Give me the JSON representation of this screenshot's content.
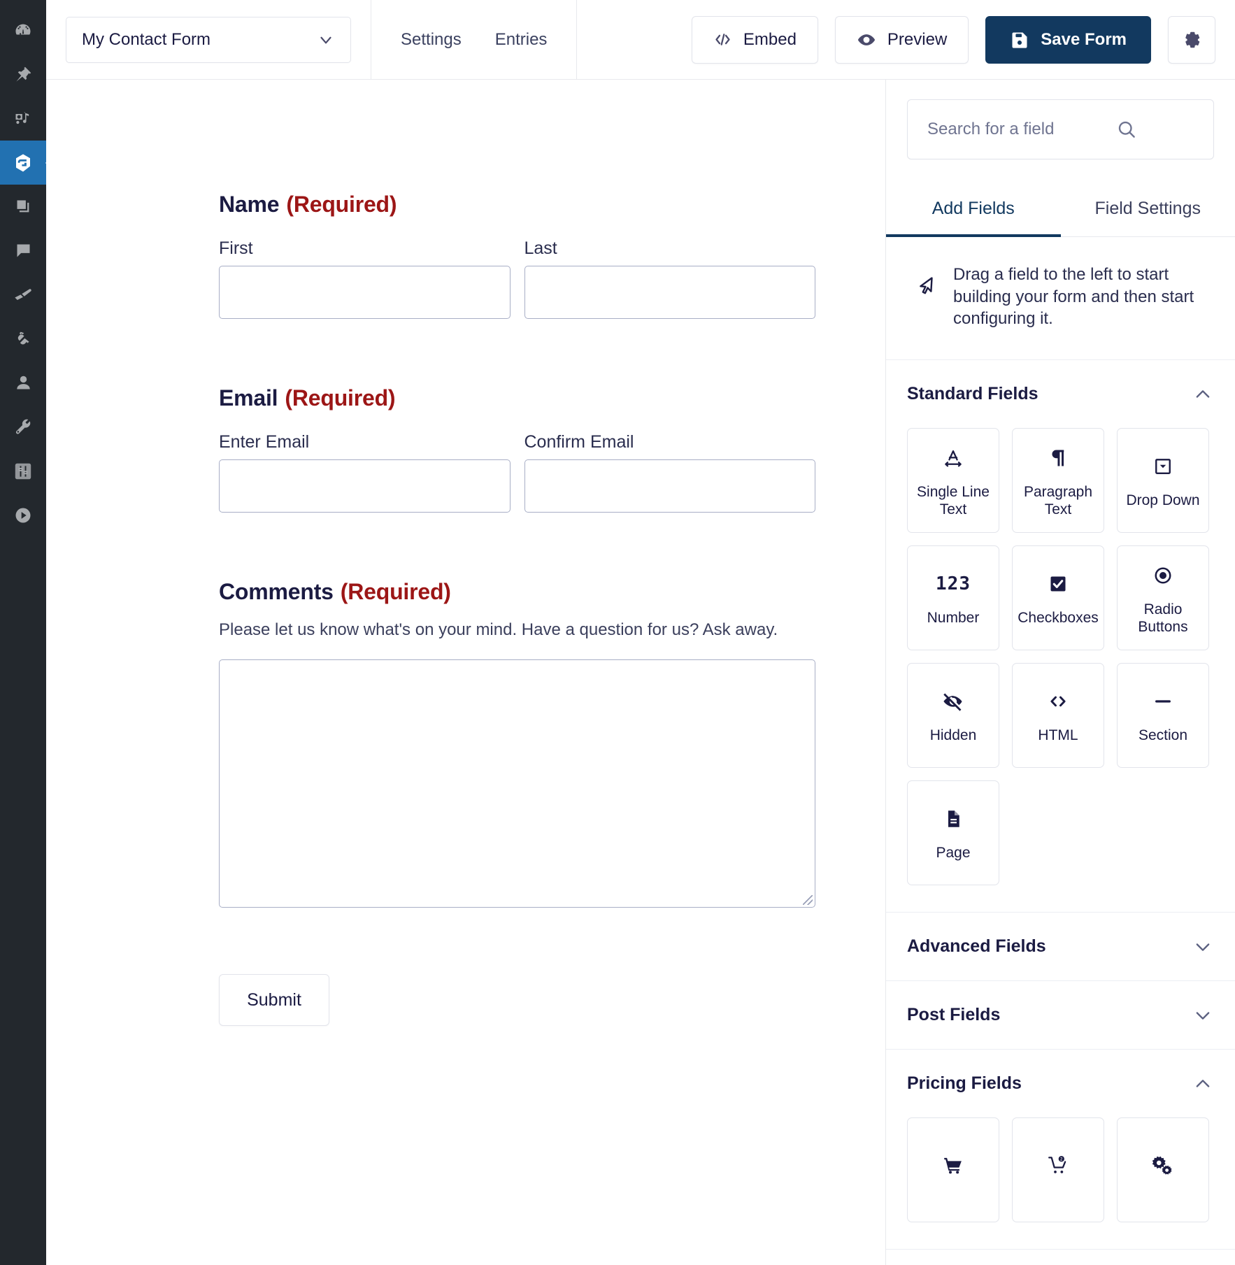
{
  "wp_rail": {
    "items": [
      {
        "name": "dashboard",
        "icon": "gauge-icon",
        "active": false
      },
      {
        "name": "pins",
        "icon": "pin-icon",
        "active": false
      },
      {
        "name": "media",
        "icon": "media-icon",
        "active": false
      },
      {
        "name": "gravity-forms",
        "icon": "gravity-forms-icon",
        "active": true
      },
      {
        "name": "pages",
        "icon": "pages-icon",
        "active": false
      },
      {
        "name": "comments",
        "icon": "comment-icon",
        "active": false
      },
      {
        "name": "appearance",
        "icon": "paintbrush-icon",
        "active": false
      },
      {
        "name": "plugins",
        "icon": "plug-icon",
        "active": false
      },
      {
        "name": "users",
        "icon": "user-icon",
        "active": false
      },
      {
        "name": "tools",
        "icon": "wrench-icon",
        "active": false
      },
      {
        "name": "settings",
        "icon": "sliders-icon",
        "active": false
      },
      {
        "name": "media-player",
        "icon": "play-circle-icon",
        "active": false
      }
    ]
  },
  "topbar": {
    "form_name": "My Contact Form",
    "dropdown_icon": "chevron-down-icon",
    "nav": [
      {
        "label": "Settings",
        "name": "settings"
      },
      {
        "label": "Entries",
        "name": "entries"
      }
    ],
    "embed_label": "Embed",
    "embed_icon": "code-brackets-icon",
    "preview_label": "Preview",
    "preview_icon": "eye-icon",
    "save_label": "Save Form",
    "save_icon": "floppy-disk-icon",
    "gear_icon": "gear-icon",
    "primary_color": "#12395f"
  },
  "form": {
    "required_color": "#9c1616",
    "fields": [
      {
        "title": "Name",
        "required_text": "(Required)",
        "description": "",
        "type": "name",
        "subfields": [
          {
            "label": "First",
            "value": ""
          },
          {
            "label": "Last",
            "value": ""
          }
        ]
      },
      {
        "title": "Email",
        "required_text": "(Required)",
        "description": "",
        "type": "email",
        "subfields": [
          {
            "label": "Enter Email",
            "value": ""
          },
          {
            "label": "Confirm Email",
            "value": ""
          }
        ]
      },
      {
        "title": "Comments",
        "required_text": "(Required)",
        "description": "Please let us know what's on your mind. Have a question for us? Ask away.",
        "type": "textarea",
        "subfields": []
      }
    ],
    "submit_label": "Submit"
  },
  "panel": {
    "search_placeholder": "Search for a field",
    "search_value": "",
    "search_icon": "search-icon",
    "tabs": [
      {
        "label": "Add Fields",
        "name": "add-fields",
        "active": true
      },
      {
        "label": "Field Settings",
        "name": "field-settings",
        "active": false
      }
    ],
    "hint_text": "Drag a field to the left to start building your form and then start configuring it.",
    "hint_icon": "cursor-arrow-icon",
    "sections": [
      {
        "title": "Standard Fields",
        "expanded": true,
        "chevron": "chevron-up-icon",
        "tiles": [
          {
            "label": "Single Line Text",
            "icon": "single-line-text-icon"
          },
          {
            "label": "Paragraph Text",
            "icon": "paragraph-icon"
          },
          {
            "label": "Drop Down",
            "icon": "dropdown-icon"
          },
          {
            "label": "Number",
            "icon": "number-123-icon"
          },
          {
            "label": "Checkboxes",
            "icon": "checkbox-checked-icon"
          },
          {
            "label": "Radio Buttons",
            "icon": "radio-selected-icon"
          },
          {
            "label": "Hidden",
            "icon": "eye-slash-icon"
          },
          {
            "label": "HTML",
            "icon": "code-brackets-icon"
          },
          {
            "label": "Section",
            "icon": "horizontal-rule-icon"
          },
          {
            "label": "Page",
            "icon": "page-document-icon"
          }
        ]
      },
      {
        "title": "Advanced Fields",
        "expanded": false,
        "chevron": "chevron-down-icon",
        "tiles": []
      },
      {
        "title": "Post Fields",
        "expanded": false,
        "chevron": "chevron-down-icon",
        "tiles": []
      },
      {
        "title": "Pricing Fields",
        "expanded": true,
        "chevron": "chevron-up-icon",
        "tiles": [
          {
            "label": "",
            "icon": "shopping-cart-icon"
          },
          {
            "label": "",
            "icon": "shopping-cart-quantity-icon"
          },
          {
            "label": "",
            "icon": "gears-icon"
          }
        ]
      }
    ]
  }
}
